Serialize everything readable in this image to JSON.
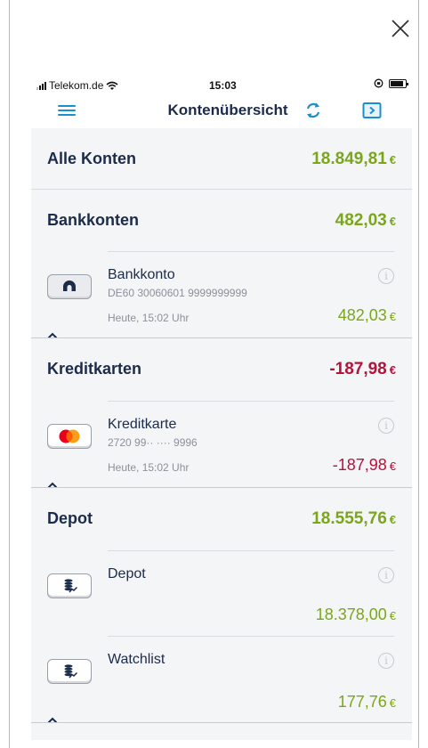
{
  "status_bar": {
    "carrier": "Telekom.de",
    "time": "15:03"
  },
  "navbar": {
    "title": "Kontenübersicht"
  },
  "overview": {
    "label": "Alle Konten",
    "amount": "18.849,81",
    "currency": "€"
  },
  "sections": [
    {
      "label": "Bankkonten",
      "amount": "482,03",
      "currency": "€",
      "accounts": [
        {
          "name": "Bankkonto",
          "iban": "DE60 30060601 9999999999",
          "updated": "Heute, 15:02 Uhr",
          "amount": "482,03",
          "currency": "€"
        }
      ]
    },
    {
      "label": "Kreditkarten",
      "amount": "-187,98",
      "currency": "€",
      "accounts": [
        {
          "name": "Kreditkarte",
          "card_number": "2720 99·· ···· 9996",
          "updated": "Heute, 15:02 Uhr",
          "amount": "-187,98",
          "currency": "€"
        }
      ]
    },
    {
      "label": "Depot",
      "amount": "18.555,76",
      "currency": "€",
      "accounts": [
        {
          "name": "Depot",
          "amount": "18.378,00",
          "currency": "€"
        },
        {
          "name": "Watchlist",
          "amount": "177,76",
          "currency": "€"
        }
      ]
    }
  ],
  "colors": {
    "positive": "#7ba61c",
    "negative": "#b3143c",
    "accent": "#1a8fd0",
    "text": "#1c2b4a"
  }
}
